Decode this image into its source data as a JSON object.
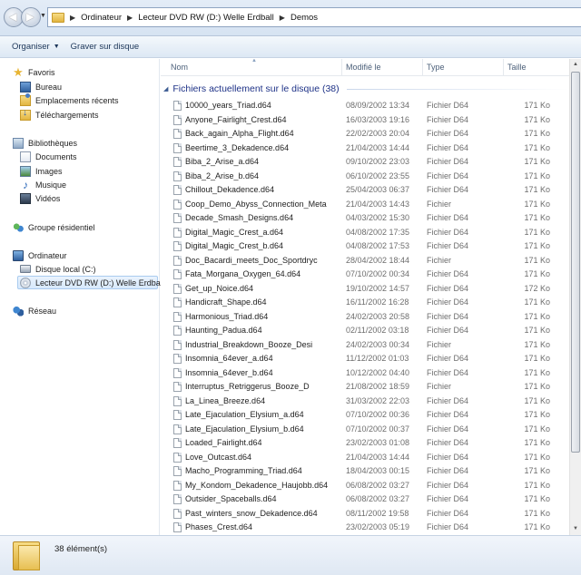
{
  "address": {
    "crumbs": [
      "Ordinateur",
      "Lecteur DVD RW (D:) Welle Erdball",
      "Demos"
    ]
  },
  "toolbar": {
    "organize_label": "Organiser",
    "burn_label": "Graver sur disque"
  },
  "nav": {
    "favorites": "Favoris",
    "desktop": "Bureau",
    "recent_places": "Emplacements récents",
    "downloads": "Téléchargements",
    "libraries": "Bibliothèques",
    "documents": "Documents",
    "images": "Images",
    "music": "Musique",
    "videos": "Vidéos",
    "homegroup": "Groupe résidentiel",
    "computer": "Ordinateur",
    "local_disk": "Disque local (C:)",
    "dvd_drive": "Lecteur DVD RW (D:) Welle Erdball",
    "network": "Réseau"
  },
  "columns": {
    "name": "Nom",
    "modified": "Modifié le",
    "type": "Type",
    "size": "Taille"
  },
  "group_header": "Fichiers actuellement sur le disque (38)",
  "files": [
    {
      "name": "10000_years_Triad.d64",
      "date": "08/09/2002 13:34",
      "type": "Fichier D64",
      "size": "171 Ko"
    },
    {
      "name": "Anyone_Fairlight_Crest.d64",
      "date": "16/03/2003 19:16",
      "type": "Fichier D64",
      "size": "171 Ko"
    },
    {
      "name": "Back_again_Alpha_Flight.d64",
      "date": "22/02/2003 20:04",
      "type": "Fichier D64",
      "size": "171 Ko"
    },
    {
      "name": "Beertime_3_Dekadence.d64",
      "date": "21/04/2003 14:44",
      "type": "Fichier D64",
      "size": "171 Ko"
    },
    {
      "name": "Biba_2_Arise_a.d64",
      "date": "09/10/2002 23:03",
      "type": "Fichier D64",
      "size": "171 Ko"
    },
    {
      "name": "Biba_2_Arise_b.d64",
      "date": "06/10/2002 23:55",
      "type": "Fichier D64",
      "size": "171 Ko"
    },
    {
      "name": "Chillout_Dekadence.d64",
      "date": "25/04/2003 06:37",
      "type": "Fichier D64",
      "size": "171 Ko"
    },
    {
      "name": "Coop_Demo_Abyss_Connection_Meta",
      "date": "21/04/2003 14:43",
      "type": "Fichier",
      "size": "171 Ko"
    },
    {
      "name": "Decade_Smash_Designs.d64",
      "date": "04/03/2002 15:30",
      "type": "Fichier D64",
      "size": "171 Ko"
    },
    {
      "name": "Digital_Magic_Crest_a.d64",
      "date": "04/08/2002 17:35",
      "type": "Fichier D64",
      "size": "171 Ko"
    },
    {
      "name": "Digital_Magic_Crest_b.d64",
      "date": "04/08/2002 17:53",
      "type": "Fichier D64",
      "size": "171 Ko"
    },
    {
      "name": "Doc_Bacardi_meets_Doc_Sportdryc",
      "date": "28/04/2002 18:44",
      "type": "Fichier",
      "size": "171 Ko"
    },
    {
      "name": "Fata_Morgana_Oxygen_64.d64",
      "date": "07/10/2002 00:34",
      "type": "Fichier D64",
      "size": "171 Ko"
    },
    {
      "name": "Get_up_Noice.d64",
      "date": "19/10/2002 14:57",
      "type": "Fichier D64",
      "size": "172 Ko"
    },
    {
      "name": "Handicraft_Shape.d64",
      "date": "16/11/2002 16:28",
      "type": "Fichier D64",
      "size": "171 Ko"
    },
    {
      "name": "Harmonious_Triad.d64",
      "date": "24/02/2003 20:58",
      "type": "Fichier D64",
      "size": "171 Ko"
    },
    {
      "name": "Haunting_Padua.d64",
      "date": "02/11/2002 03:18",
      "type": "Fichier D64",
      "size": "171 Ko"
    },
    {
      "name": "Industrial_Breakdown_Booze_Desi",
      "date": "24/02/2003 00:34",
      "type": "Fichier",
      "size": "171 Ko"
    },
    {
      "name": "Insomnia_64ever_a.d64",
      "date": "11/12/2002 01:03",
      "type": "Fichier D64",
      "size": "171 Ko"
    },
    {
      "name": "Insomnia_64ever_b.d64",
      "date": "10/12/2002 04:40",
      "type": "Fichier D64",
      "size": "171 Ko"
    },
    {
      "name": "Interruptus_Retriggerus_Booze_D",
      "date": "21/08/2002 18:59",
      "type": "Fichier",
      "size": "171 Ko"
    },
    {
      "name": "La_Linea_Breeze.d64",
      "date": "31/03/2002 22:03",
      "type": "Fichier D64",
      "size": "171 Ko"
    },
    {
      "name": "Late_Ejaculation_Elysium_a.d64",
      "date": "07/10/2002 00:36",
      "type": "Fichier D64",
      "size": "171 Ko"
    },
    {
      "name": "Late_Ejaculation_Elysium_b.d64",
      "date": "07/10/2002 00:37",
      "type": "Fichier D64",
      "size": "171 Ko"
    },
    {
      "name": "Loaded_Fairlight.d64",
      "date": "23/02/2003 01:08",
      "type": "Fichier D64",
      "size": "171 Ko"
    },
    {
      "name": "Love_Outcast.d64",
      "date": "21/04/2003 14:44",
      "type": "Fichier D64",
      "size": "171 Ko"
    },
    {
      "name": "Macho_Programming_Triad.d64",
      "date": "18/04/2003 00:15",
      "type": "Fichier D64",
      "size": "171 Ko"
    },
    {
      "name": "My_Kondom_Dekadence_Haujobb.d64",
      "date": "06/08/2002 03:27",
      "type": "Fichier D64",
      "size": "171 Ko"
    },
    {
      "name": "Outsider_Spaceballs.d64",
      "date": "06/08/2002 03:27",
      "type": "Fichier D64",
      "size": "171 Ko"
    },
    {
      "name": "Past_winters_snow_Dekadence.d64",
      "date": "08/11/2002 19:58",
      "type": "Fichier D64",
      "size": "171 Ko"
    },
    {
      "name": "Phases_Crest.d64",
      "date": "23/02/2003 05:19",
      "type": "Fichier D64",
      "size": "171 Ko"
    }
  ],
  "status": {
    "count": "38 élément(s)"
  }
}
